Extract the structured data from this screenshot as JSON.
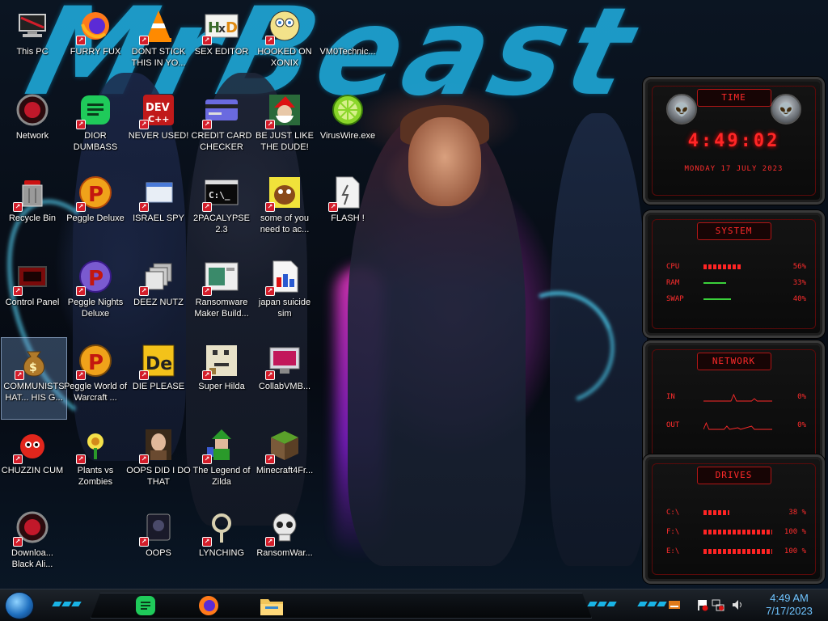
{
  "wallpaper": {
    "title_text": "MrBeast"
  },
  "icons": [
    {
      "id": "this-pc",
      "label": "This PC",
      "icon": "computer-icon"
    },
    {
      "id": "furry-fux",
      "label": "FURRY FUX",
      "icon": "firefox-icon"
    },
    {
      "id": "dont-stick",
      "label": "DONT STICK THIS IN YO...",
      "icon": "vlc-cone-icon"
    },
    {
      "id": "sex-editor",
      "label": "SEX EDITOR",
      "icon": "hxd-icon"
    },
    {
      "id": "hooked-on-xonix",
      "label": "HOOKED ON XONIX",
      "icon": "cartoon-icon"
    },
    {
      "id": "vm0",
      "label": "VM0Technic...",
      "icon": "none"
    },
    {
      "id": "network",
      "label": "Network",
      "icon": "network-orb-icon"
    },
    {
      "id": "dior-dumbass",
      "label": "DIOR DUMBASS",
      "icon": "green-doc-icon"
    },
    {
      "id": "never-used",
      "label": "NEVER USED!",
      "icon": "devcpp-icon"
    },
    {
      "id": "credit-card",
      "label": "CREDIT CARD CHECKER",
      "icon": "credit-card-icon"
    },
    {
      "id": "be-just-like",
      "label": "BE JUST LIKE THE DUDE!",
      "icon": "santa-icon"
    },
    {
      "id": "virus-wire",
      "label": "VirusWire.exe",
      "icon": "lime-icon"
    },
    {
      "id": "recycle-bin",
      "label": "Recycle Bin",
      "icon": "recycle-bin-icon"
    },
    {
      "id": "peggle-deluxe",
      "label": "Peggle Deluxe",
      "icon": "peggle-icon"
    },
    {
      "id": "israel-spy",
      "label": "ISRAEL SPY",
      "icon": "window-app-icon"
    },
    {
      "id": "2pacalypse",
      "label": "2PACALYPSE 2.3",
      "icon": "terminal-icon"
    },
    {
      "id": "some-of-you",
      "label": "some of you need to ac...",
      "icon": "beaver-icon"
    },
    {
      "id": "flash",
      "label": "FLASH !",
      "icon": "flash-doc-icon"
    },
    {
      "id": "control-panel",
      "label": "Control Panel",
      "icon": "control-panel-icon"
    },
    {
      "id": "peggle-nights",
      "label": "Peggle Nights Deluxe",
      "icon": "peggle-icon"
    },
    {
      "id": "deez-nutz",
      "label": "DEEZ NUTZ",
      "icon": "stacked-windows-icon"
    },
    {
      "id": "ransomware-maker",
      "label": "Ransomware Maker Build...",
      "icon": "app-window-icon"
    },
    {
      "id": "japan-suicide",
      "label": "japan suicide sim",
      "icon": "installer-icon"
    },
    {
      "id": "communists",
      "label": "COMMUNISTS HAT... HIS G...",
      "icon": "money-bag-icon"
    },
    {
      "id": "peggle-wow",
      "label": "Peggle World of Warcraft ...",
      "icon": "peggle-icon"
    },
    {
      "id": "die-please",
      "label": "DIE PLEASE",
      "icon": "de-icon"
    },
    {
      "id": "super-hilda",
      "label": "Super Hilda",
      "icon": "pixel-art-icon"
    },
    {
      "id": "collabvmb",
      "label": "CollabVMB...",
      "icon": "monitor-icon"
    },
    {
      "id": "chuzzin-cum",
      "label": "CHUZZIN CUM",
      "icon": "red-fuzzball-icon"
    },
    {
      "id": "plants-vs-zombies",
      "label": "Plants vs Zombies",
      "icon": "flower-icon"
    },
    {
      "id": "oops-did-i",
      "label": "OOPS DID I DO THAT",
      "icon": "portrait-icon"
    },
    {
      "id": "legend-of-zilda",
      "label": "The Legend of Zilda",
      "icon": "link-sprite-icon"
    },
    {
      "id": "minecraft",
      "label": "Minecraft4Fr...",
      "icon": "grass-block-icon"
    },
    {
      "id": "download-black-alien",
      "label": "Downloa... Black Ali...",
      "icon": "network-orb-icon"
    },
    {
      "id": "oops",
      "label": "OOPS",
      "icon": "dark-app-icon"
    },
    {
      "id": "lynching",
      "label": "LYNCHING",
      "icon": "rope-icon"
    },
    {
      "id": "ransomware",
      "label": "RansomWar...",
      "icon": "skull-icon"
    }
  ],
  "widgets": {
    "time": {
      "title": "TIME",
      "clock": "4:49:02",
      "date": "MONDAY 17 JULY 2023"
    },
    "system": {
      "title": "SYSTEM",
      "rows": [
        {
          "label": "CPU",
          "value": "56%",
          "level": 0.56
        },
        {
          "label": "RAM",
          "value": "33%",
          "level": 0.33
        },
        {
          "label": "SWAP",
          "value": "40%",
          "level": 0.4
        }
      ]
    },
    "network": {
      "title": "NETWORK",
      "rows": [
        {
          "label": "IN",
          "value": "0%"
        },
        {
          "label": "OUT",
          "value": "0%"
        }
      ]
    },
    "drives": {
      "title": "DRIVES",
      "rows": [
        {
          "label": "C:\\",
          "value": "38 %",
          "level": 0.38
        },
        {
          "label": "F:\\",
          "value": "100 %",
          "level": 1.0
        },
        {
          "label": "E:\\",
          "value": "100 %",
          "level": 1.0
        }
      ]
    }
  },
  "taskbar": {
    "pinned": [
      {
        "name": "notes-app-icon"
      },
      {
        "name": "firefox-icon"
      },
      {
        "name": "file-explorer-icon"
      }
    ],
    "tray": [
      "drive-icon",
      "flag-icon",
      "network-icon",
      "volume-icon"
    ],
    "clock_time": "4:49 AM",
    "clock_date": "7/17/2023"
  },
  "colors": {
    "accent_red": "#ff2626",
    "wallpaper_blue": "#1fa8d8",
    "clock_blue": "#6fc4ff"
  }
}
